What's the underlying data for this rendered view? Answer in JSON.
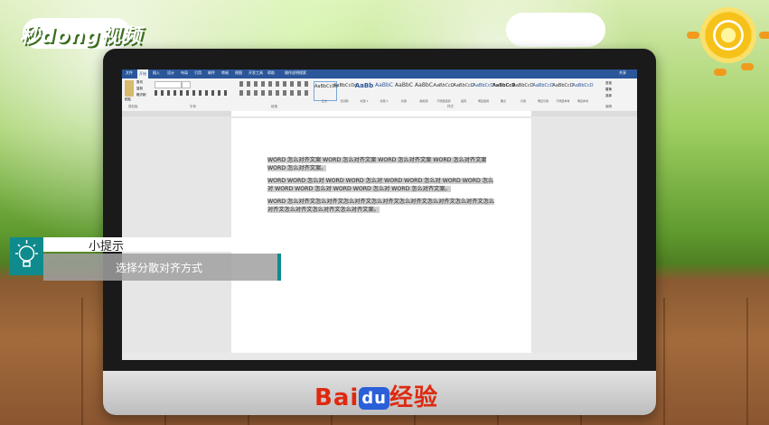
{
  "branding": {
    "watermark": "秒dong视频",
    "footer_logo_prefix": "Bai",
    "footer_logo_du": "du",
    "footer_logo_suffix": "经验"
  },
  "word": {
    "menu_tabs": [
      "文件",
      "开始",
      "插入",
      "设计",
      "布局",
      "引用",
      "邮件",
      "审阅",
      "视图",
      "开发工具",
      "帮助",
      "操作说明搜索",
      "共享"
    ],
    "active_tab": "开始",
    "ribbon_groups": [
      "剪贴板",
      "字体",
      "段落",
      "样式",
      "编辑"
    ],
    "clipboard": {
      "paste": "粘贴",
      "cut": "剪切",
      "copy": "复制",
      "format_painter": "格式刷"
    },
    "styles": [
      {
        "preview": "AaBbCcDc",
        "name": "正文"
      },
      {
        "preview": "AaBbCcDc",
        "name": "无间隔"
      },
      {
        "preview": "AaBb",
        "name": "标题 1"
      },
      {
        "preview": "AaBbC",
        "name": "标题 2"
      },
      {
        "preview": "AaBbC",
        "name": "标题"
      },
      {
        "preview": "AaBbC",
        "name": "副标题"
      },
      {
        "preview": "AaBbCcD",
        "name": "不明显强调"
      },
      {
        "preview": "AaBbCcD",
        "name": "强调"
      },
      {
        "preview": "AaBbCcD",
        "name": "明显强调"
      },
      {
        "preview": "AaBbCcD",
        "name": "要点"
      },
      {
        "preview": "AaBbCcD",
        "name": "引用"
      },
      {
        "preview": "AaBbCcD",
        "name": "明显引用"
      },
      {
        "preview": "AaBbCcD",
        "name": "不明显参考"
      },
      {
        "preview": "AaBbCcD",
        "name": "明显参考"
      }
    ],
    "editing": {
      "find": "查找",
      "replace": "替换",
      "select": "选择"
    },
    "document": {
      "paragraphs": [
        "WORD 怎么对齐文案 WORD 怎么对齐文案 WORD 怎么对齐文案 WORD 怎么对齐文案 WORD 怎么对齐文案。",
        "WORD WORD 怎么对 WORD WORD 怎么对 WORD WORD 怎么对 WORD WORD 怎么对 WORD WORD 怎么对 WORD WORD 怎么对 WORD 怎么对齐文案。",
        "WORD 怎么对齐文怎么对齐文怎么对齐文怎么对齐文怎么对齐文怎么对齐文怎么对齐文怎么对齐文怎么对齐文怎么对齐文怎么对齐文案。"
      ]
    }
  },
  "tip": {
    "title": "小提示",
    "text": "选择分散对齐方式"
  },
  "colors": {
    "word_blue": "#2b579a",
    "teal": "#0f8b8d",
    "baidu_red": "#de2910",
    "baidu_blue": "#2b5fd9"
  }
}
